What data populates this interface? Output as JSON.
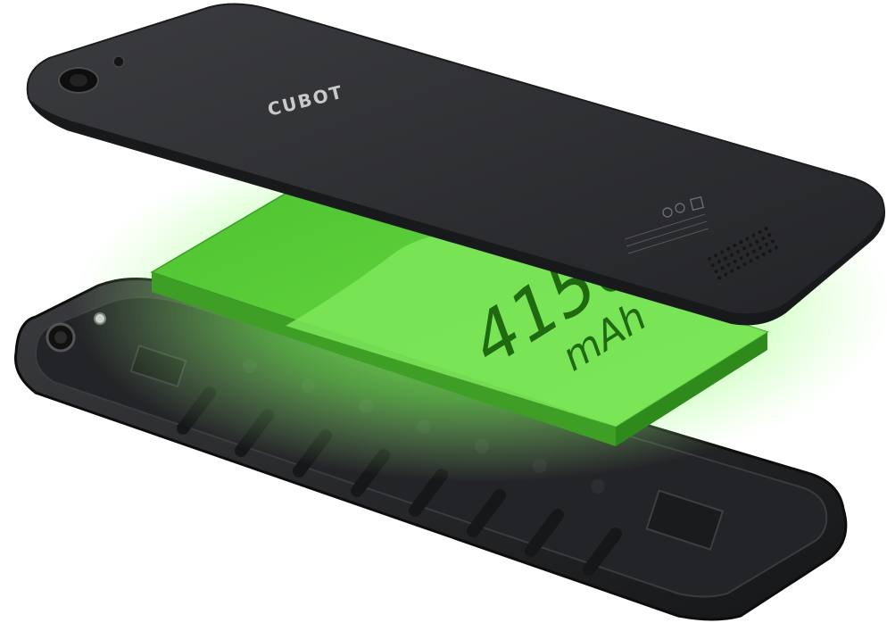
{
  "product": {
    "brand_logo": "CUBOT",
    "battery_capacity": "4150",
    "battery_unit": "mAh"
  },
  "colors": {
    "glow": "#7dff5a",
    "battery_green": "#5ed33a",
    "battery_dark_green": "#3a9d25",
    "phone_body": "#2f3033",
    "phone_frame": "#1a1b1d",
    "logo": "#c9c9c9"
  },
  "icons": {
    "rear_camera": "camera-lens-icon",
    "flash": "flash-icon",
    "speaker_grille": "speaker-grille-icon"
  }
}
